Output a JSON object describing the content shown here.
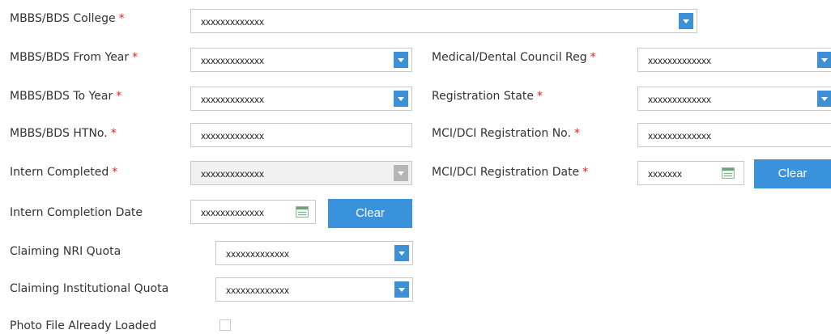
{
  "form": {
    "college": {
      "label": "MBBS/BDS College",
      "required": "*",
      "value": "xxxxxxxxxxxxx"
    },
    "from_year": {
      "label": "MBBS/BDS From Year",
      "required": "*",
      "value": "xxxxxxxxxxxxx"
    },
    "to_year": {
      "label": "MBBS/BDS To Year",
      "required": "*",
      "value": "xxxxxxxxxxxxx"
    },
    "htno": {
      "label": "MBBS/BDS HTNo.",
      "required": "*",
      "value": "xxxxxxxxxxxxx"
    },
    "intern_completed": {
      "label": "Intern Completed",
      "required": "*",
      "value": "xxxxxxxxxxxxx",
      "disabled": true
    },
    "intern_completion_date": {
      "label": "Intern Completion Date",
      "value": "xxxxxxxxxxxxx",
      "clear_label": "Clear"
    },
    "nri_quota": {
      "label": "Claiming NRI Quota",
      "value": "xxxxxxxxxxxxx"
    },
    "institutional_quota": {
      "label": "Claiming Institutional Quota",
      "value": "xxxxxxxxxxxxx"
    },
    "photo_loaded": {
      "label": "Photo File Already Loaded",
      "checked": false
    },
    "council_reg": {
      "label": "Medical/Dental Council Reg",
      "required": "*",
      "value": "xxxxxxxxxxxxx"
    },
    "registration_state": {
      "label": "Registration State",
      "required": "*",
      "value": "xxxxxxxxxxxxx"
    },
    "mci_reg_no": {
      "label": "MCI/DCI Registration No.",
      "required": "*",
      "value": "xxxxxxxxxxxxx"
    },
    "mci_reg_date": {
      "label": "MCI/DCI Registration Date",
      "required": "*",
      "value": "xxxxxxx",
      "clear_label": "Clear"
    }
  },
  "colors": {
    "accent": "#3a91dc",
    "required": "#e0202a",
    "disabled_dropdown": "#b5b5b5"
  },
  "icons": {
    "dropdown": "chevron-down-icon",
    "calendar": "calendar-icon"
  }
}
